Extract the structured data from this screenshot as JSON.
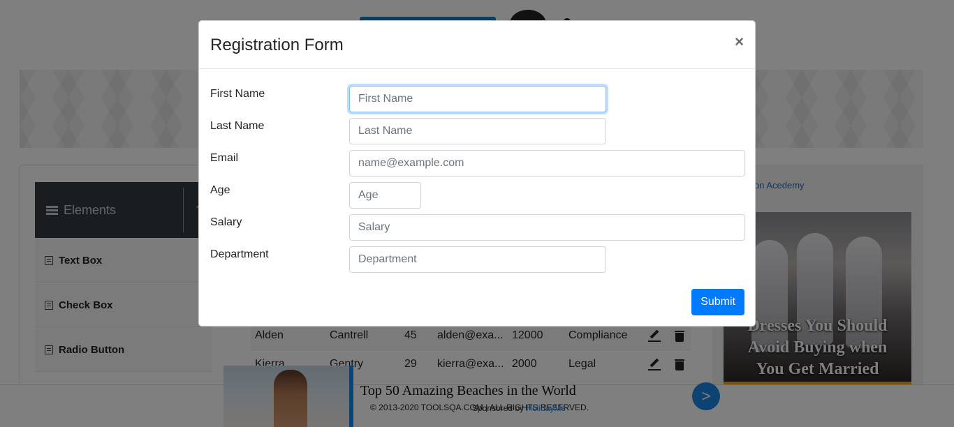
{
  "background": {
    "sidebar": {
      "header": "Elements",
      "items": [
        {
          "label": "Text Box"
        },
        {
          "label": "Check Box"
        },
        {
          "label": "Radio Button"
        }
      ]
    },
    "table": {
      "rows": [
        {
          "first": "Alden",
          "last": "Cantrell",
          "age": "45",
          "email": "alden@exa...",
          "salary": "12000",
          "department": "Compliance"
        },
        {
          "first": "Kierra",
          "last": "Gentry",
          "age": "29",
          "email": "kierra@exa...",
          "salary": "2000",
          "department": "Legal"
        }
      ]
    },
    "right_ad": {
      "link_text": "on Acedemy",
      "headline_lines": [
        "Dresses You Should",
        "Avoid Buying when",
        "You Get Married"
      ]
    },
    "bottom_ad": {
      "title": "Top 50 Amazing Beaches in the World",
      "sponsor_prefix": "Sponsored by",
      "sponsor_name": "HolidayMe",
      "next_label": ">"
    },
    "footer": {
      "copyright": "© 2013-2020 TOOLSQA.COM | ALL RIGHTS RESERVED."
    }
  },
  "modal": {
    "title": "Registration Form",
    "close_label": "×",
    "fields": [
      {
        "label": "First Name",
        "placeholder": "First Name",
        "value": ""
      },
      {
        "label": "Last Name",
        "placeholder": "Last Name",
        "value": ""
      },
      {
        "label": "Email",
        "placeholder": "name@example.com",
        "value": ""
      },
      {
        "label": "Age",
        "placeholder": "Age",
        "value": ""
      },
      {
        "label": "Salary",
        "placeholder": "Salary",
        "value": ""
      },
      {
        "label": "Department",
        "placeholder": "Department",
        "value": ""
      }
    ],
    "submit_label": "Submit"
  },
  "colors": {
    "primary": "#007bff",
    "sidebar_header": "#353b41",
    "ad_accent": "#1b86e6"
  }
}
